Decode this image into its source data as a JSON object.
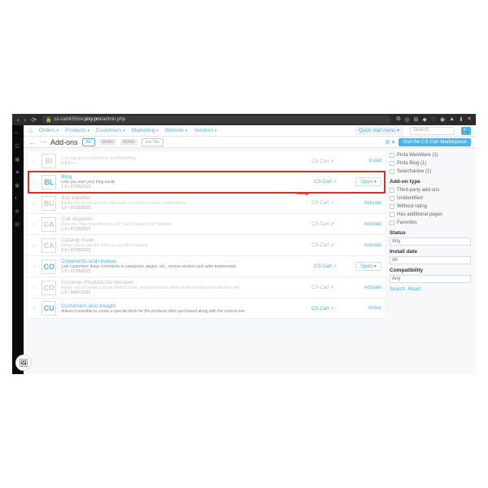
{
  "browser": {
    "url_pre": "cs-cart435mv.",
    "url_hl": "pixy.pro",
    "url_post": "/admin.php"
  },
  "menu": {
    "items": [
      "Orders",
      "Products",
      "Customers",
      "Marketing",
      "Website",
      "Vendors"
    ],
    "quick": "Quick start menu",
    "search": "Search"
  },
  "header": {
    "title": "Add-ons",
    "tab_all": "All",
    "demo1": "DEMO",
    "demo2": "DEMO",
    "store": "ma Sto",
    "visit": "Visit the CS-Cart Marketplace"
  },
  "rows": [
    {
      "sq": "BI",
      "name": "",
      "desc": "Lets you accept payments via BillriantPay",
      "ver": "1.0.1 • —",
      "dev": "CS-Cart",
      "action": "Install",
      "dim": true,
      "btn": false
    },
    {
      "sq": "BL",
      "name": "Blog",
      "desc": "Lets you start your blog easily",
      "ver": "1.0 • 07/28/2021",
      "dev": "CS-Cart",
      "action": "Open ▾",
      "dim": false,
      "btn": true,
      "hl": true
    },
    {
      "sq": "BU",
      "name": "Buy together",
      "desc": "Allows you to set up share discounts on certain product combinations",
      "ver": "1.0 • 07/28/2021",
      "dev": "CS-Cart",
      "action": "Activate",
      "dim": true,
      "btn": false
    },
    {
      "sq": "CA",
      "name": "Call requests",
      "desc": "Adds the \"Buy now with one click\" and \"Request call\" buttons",
      "ver": "1.0 • 07/28/2021",
      "dev": "CS-Cart",
      "action": "Activate",
      "dim": true,
      "btn": false
    },
    {
      "sq": "CA",
      "name": "Catalog mode",
      "desc": "Allows you to use the store as a product catalog",
      "ver": "1.0 • 07/28/2021",
      "dev": "CS-Cart",
      "action": "Activate",
      "dim": true,
      "btn": false
    },
    {
      "sq": "CO",
      "name": "Comments and reviews",
      "desc": "Lets customers leave comments to categories, pages, etc., review vendors and write testimonials",
      "ver": "1.0 • 07/28/2021",
      "dev": "CS-Cart",
      "action": "Open ▾",
      "dim": false,
      "btn": true
    },
    {
      "sq": "CO",
      "name": "Common Products for Vendors",
      "desc": "Allows you to create a single product base: vendors choose which of the existing products they sell",
      "ver": "1.0 • 04/07/2021",
      "dev": "CS-Cart",
      "action": "Activate",
      "dim": true,
      "btn": false
    },
    {
      "sq": "CU",
      "name": "Customers also bought",
      "desc": "Makes it possible to create a special block for the products often purchased along with the current one",
      "ver": "",
      "dev": "CS-Cart",
      "action": "Active",
      "dim": false,
      "btn": false
    }
  ],
  "side": {
    "filters": [
      {
        "l": "Pinta WebWare (1)"
      },
      {
        "l": "Pinta Blog (1)"
      },
      {
        "l": "Searchanise (1)"
      }
    ],
    "type_hdr": "Add-on type",
    "types": [
      "Third-party add-ons",
      "Unidentified",
      "Without rating",
      "Has additional pages",
      "Favorites"
    ],
    "status_hdr": "Status",
    "status": "Any",
    "install_hdr": "Install date",
    "install": "All",
    "compat_hdr": "Compatibility",
    "compat": "Any",
    "search": "Search",
    "reset": "Reset"
  }
}
